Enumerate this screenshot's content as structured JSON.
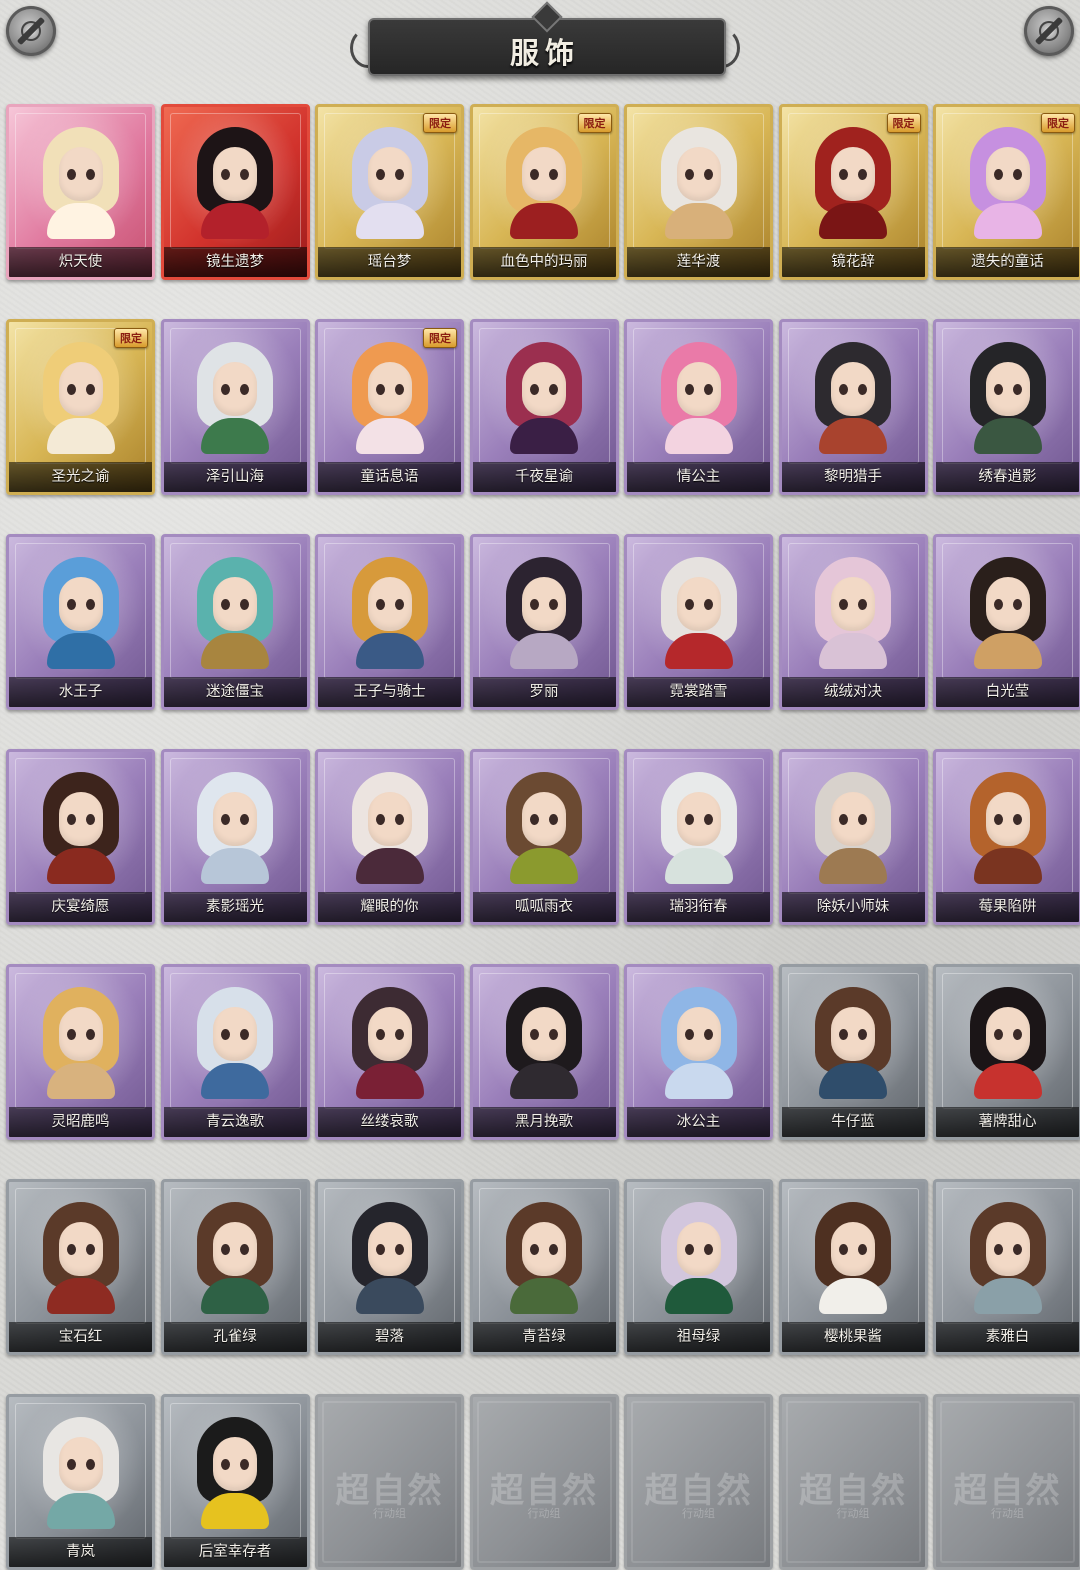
{
  "header": {
    "title": "服饰"
  },
  "skins": [
    {
      "name": "炽天使",
      "tier": "pink",
      "tag": "",
      "tag_style": "",
      "hair": "#f1e0b8",
      "body": "#fff3e2"
    },
    {
      "name": "镜生遗梦",
      "tier": "red",
      "tag": "",
      "tag_style": "",
      "hair": "#1d1416",
      "body": "#b3212b"
    },
    {
      "name": "瑶台梦",
      "tier": "gold",
      "tag": "限定",
      "tag_style": "",
      "hair": "#c9cbe6",
      "body": "#e3dff0"
    },
    {
      "name": "血色中的玛丽",
      "tier": "gold",
      "tag": "限定",
      "tag_style": "",
      "hair": "#e6b766",
      "body": "#9c1f20"
    },
    {
      "name": "莲华渡",
      "tier": "gold",
      "tag": "",
      "tag_style": "",
      "hair": "#e9e5e0",
      "body": "#d8b07a"
    },
    {
      "name": "镜花辞",
      "tier": "gold",
      "tag": "限定",
      "tag_style": "",
      "hair": "#a0221e",
      "body": "#7a1515"
    },
    {
      "name": "遗失的童话",
      "tier": "gold",
      "tag": "限定",
      "tag_style": "",
      "hair": "#c690e0",
      "body": "#e8b4e6"
    },
    {
      "name": "圣光之谕",
      "tier": "gold",
      "tag": "限定",
      "tag_style": "",
      "hair": "#efcd78",
      "body": "#f4ead6"
    },
    {
      "name": "泽引山海",
      "tier": "purple",
      "tag": "",
      "tag_style": "",
      "hair": "#dfe3e6",
      "body": "#3d7a4c"
    },
    {
      "name": "童话息语",
      "tier": "purple",
      "tag": "限定",
      "tag_style": "",
      "hair": "#ef9a50",
      "body": "#f3e1e6"
    },
    {
      "name": "千夜星谕",
      "tier": "purple",
      "tag": "",
      "tag_style": "",
      "hair": "#9b2f4f",
      "body": "#3a1f45"
    },
    {
      "name": "情公主",
      "tier": "purple",
      "tag": "",
      "tag_style": "",
      "hair": "#ea7aa8",
      "body": "#f3d3e0"
    },
    {
      "name": "黎明猎手",
      "tier": "purple",
      "tag": "",
      "tag_style": "",
      "hair": "#2d2a2f",
      "body": "#a9432e"
    },
    {
      "name": "绣春逍影",
      "tier": "purple",
      "tag": "",
      "tag_style": "",
      "hair": "#252528",
      "body": "#3a5741"
    },
    {
      "name": "水王子",
      "tier": "purple",
      "tag": "",
      "tag_style": "",
      "hair": "#5a9ed9",
      "body": "#2f6fa6"
    },
    {
      "name": "迷途僵宝",
      "tier": "purple",
      "tag": "",
      "tag_style": "",
      "hair": "#5ab2ad",
      "body": "#a8853f"
    },
    {
      "name": "王子与骑士",
      "tier": "purple",
      "tag": "",
      "tag_style": "",
      "hair": "#d79a3b",
      "body": "#3a5a86"
    },
    {
      "name": "罗丽",
      "tier": "purple",
      "tag": "",
      "tag_style": "",
      "hair": "#2c2330",
      "body": "#b7a8c3"
    },
    {
      "name": "霓裳踏雪",
      "tier": "purple",
      "tag": "",
      "tag_style": "",
      "hair": "#e6e2df",
      "body": "#b5282b"
    },
    {
      "name": "绒绒对决",
      "tier": "purple",
      "tag": "",
      "tag_style": "",
      "hair": "#e5c6d8",
      "body": "#d9c2d6"
    },
    {
      "name": "白光莹",
      "tier": "purple",
      "tag": "",
      "tag_style": "",
      "hair": "#2a1f1b",
      "body": "#cfa064"
    },
    {
      "name": "庆宴绮愿",
      "tier": "purple",
      "tag": "",
      "tag_style": "",
      "hair": "#3d241c",
      "body": "#8a2a1f"
    },
    {
      "name": "素影瑶光",
      "tier": "purple",
      "tag": "",
      "tag_style": "",
      "hair": "#dfe6ee",
      "body": "#b7c6d8"
    },
    {
      "name": "耀眼的你",
      "tier": "purple",
      "tag": "",
      "tag_style": "",
      "hair": "#ece4e0",
      "body": "#4b2a3a"
    },
    {
      "name": "呱呱雨衣",
      "tier": "purple",
      "tag": "",
      "tag_style": "",
      "hair": "#6b4a32",
      "body": "#8b9a2e"
    },
    {
      "name": "瑞羽衔春",
      "tier": "purple",
      "tag": "",
      "tag_style": "",
      "hair": "#e8eaea",
      "body": "#d7e2dd"
    },
    {
      "name": "除妖小师妹",
      "tier": "purple",
      "tag": "",
      "tag_style": "",
      "hair": "#d8d2cc",
      "body": "#9d7a52"
    },
    {
      "name": "莓果陷阱",
      "tier": "purple",
      "tag": "",
      "tag_style": "",
      "hair": "#b4632c",
      "body": "#7a3420"
    },
    {
      "name": "灵昭鹿鸣",
      "tier": "purple",
      "tag": "",
      "tag_style": "",
      "hair": "#e0b15e",
      "body": "#d8b27e"
    },
    {
      "name": "青云逸歌",
      "tier": "purple",
      "tag": "",
      "tag_style": "",
      "hair": "#d7e0ea",
      "body": "#3e6a9e"
    },
    {
      "name": "丝缕哀歌",
      "tier": "purple",
      "tag": "",
      "tag_style": "",
      "hair": "#3d2b33",
      "body": "#7a2035"
    },
    {
      "name": "黑月挽歌",
      "tier": "purple",
      "tag": "",
      "tag_style": "",
      "hair": "#1e1a1d",
      "body": "#2f2a30"
    },
    {
      "name": "冰公主",
      "tier": "purple",
      "tag": "",
      "tag_style": "",
      "hair": "#8fb6e6",
      "body": "#c9d9ee"
    },
    {
      "name": "牛仔蓝",
      "tier": "gray",
      "tag": "",
      "tag_style": "",
      "hair": "#5b3a29",
      "body": "#2f4d6b"
    },
    {
      "name": "薯牌甜心",
      "tier": "gray",
      "tag": "",
      "tag_style": "",
      "hair": "#1b1517",
      "body": "#c7322e"
    },
    {
      "name": "宝石红",
      "tier": "gray",
      "tag": "",
      "tag_style": "",
      "hair": "#5b3a29",
      "body": "#8e2b22"
    },
    {
      "name": "孔雀绿",
      "tier": "gray",
      "tag": "",
      "tag_style": "",
      "hair": "#5b3a29",
      "body": "#2e6145"
    },
    {
      "name": "碧落",
      "tier": "gray",
      "tag": "",
      "tag_style": "",
      "hair": "#25252c",
      "body": "#3a4a5d"
    },
    {
      "name": "青苔绿",
      "tier": "gray",
      "tag": "",
      "tag_style": "",
      "hair": "#5b3a29",
      "body": "#4a6a3a"
    },
    {
      "name": "祖母绿",
      "tier": "gray",
      "tag": "",
      "tag_style": "",
      "hair": "#d2c6dd",
      "body": "#1f5a3b"
    },
    {
      "name": "樱桃果酱",
      "tier": "gray",
      "tag": "",
      "tag_style": "",
      "hair": "#4e3021",
      "body": "#f1efea"
    },
    {
      "name": "素雅白",
      "tier": "gray",
      "tag": "",
      "tag_style": "",
      "hair": "#5b3a29",
      "body": "#8aa0a8"
    },
    {
      "name": "青岚",
      "tier": "gray",
      "tag": "",
      "tag_style": "",
      "hair": "#e8e6e3",
      "body": "#74a8a6"
    },
    {
      "name": "后室幸存者",
      "tier": "gray",
      "tag": "",
      "tag_style": "",
      "hair": "#1b1b1b",
      "body": "#e6c21f"
    }
  ],
  "empty_slots": [
    {
      "watermark": "超自然",
      "sub": "行动组"
    },
    {
      "watermark": "超自然",
      "sub": "行动组"
    },
    {
      "watermark": "超自然",
      "sub": "行动组"
    },
    {
      "watermark": "超自然",
      "sub": "行动组"
    },
    {
      "watermark": "超自然",
      "sub": "行动组"
    }
  ],
  "colors": {
    "background": "#d9d9d6",
    "title_plate": "#2e2e2e",
    "label_text": "#f3f0ea"
  },
  "icons": {
    "corner_left": "settings-dial-icon",
    "corner_right": "settings-dial-icon"
  }
}
